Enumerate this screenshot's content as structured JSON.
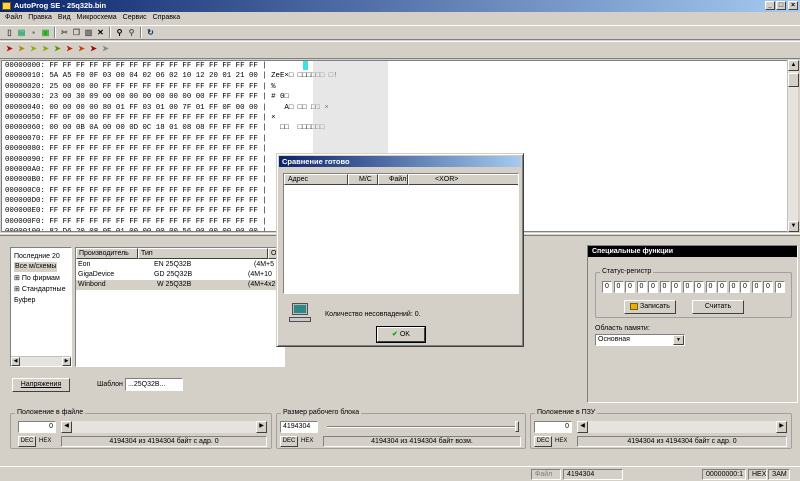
{
  "window": {
    "title": "AutoProg SE - 25q32b.bin",
    "min": "_",
    "max": "□",
    "close": "×"
  },
  "menu": [
    "Файл",
    "Правка",
    "Вид",
    "Микросхема",
    "Сервис",
    "Справка"
  ],
  "hex": {
    "rows": [
      [
        "00000000:",
        "FF FF FF FF FF FF FF FF FF FF FF FF FF FF FF FF |",
        ""
      ],
      [
        "00000010:",
        "5A A5 F0 0F 03 00 04 02 06 02 10 12 20 01 21 00 |",
        "ZeE×□ □□□□□□ □!"
      ],
      [
        "00000020:",
        "25 00 00 00 FF FF FF FF FF FF FF FF FF FF FF FF |",
        "%"
      ],
      [
        "00000030:",
        "23 00 30 09 00 00 00 00 00 00 00 00 FF FF FF FF |",
        "# 0□"
      ],
      [
        "00000040:",
        "00 00 00 00 80 01 FF 03 01 00 7F 01 FF 0F 00 00 |",
        "   A□ □□ □□ ×"
      ],
      [
        "00000050:",
        "FF 0F 00 00 FF FF FF FF FF FF FF FF FF FF FF FF |",
        "×"
      ],
      [
        "00000060:",
        "00 00 0B 0A 00 00 0D 0C 18 01 08 08 FF FF FF FF |",
        "  □□  □□□□□□"
      ],
      [
        "00000070:",
        "FF FF FF FF FF FF FF FF FF FF FF FF FF FF FF FF |",
        ""
      ],
      [
        "00000080:",
        "FF FF FF FF FF FF FF FF FF FF FF FF FF FF FF FF |",
        ""
      ],
      [
        "00000090:",
        "FF FF FF FF FF FF FF FF FF FF FF FF FF FF FF FF |",
        ""
      ],
      [
        "000000A0:",
        "FF FF FF FF FF FF FF FF FF FF FF FF FF FF FF FF |",
        ""
      ],
      [
        "000000B0:",
        "FF FF FF FF FF FF FF FF FF FF FF FF FF FF FF FF |",
        ""
      ],
      [
        "000000C0:",
        "FF FF FF FF FF FF FF FF FF FF FF FF FF FF FF FF |",
        ""
      ],
      [
        "000000D0:",
        "FF FF FF FF FF FF FF FF FF FF FF FF FF FF FF FF |",
        ""
      ],
      [
        "000000E0:",
        "FF FF FF FF FF FF FF FF FF FF FF FF FF FF FF FF |",
        ""
      ],
      [
        "000000F0:",
        "FF FF FF FF FF FF FF FF FF FF FF FF FF FF FF FF |",
        ""
      ],
      [
        "00000100:",
        "82 D6 20 08 0F 01 00 00 00 00 56 00 00 00 00 00 |",
        ""
      ]
    ]
  },
  "tree": [
    "Последние 20",
    "Все м/схемы",
    "По фирмам",
    "Стандартные",
    "Буфер"
  ],
  "chip_list": {
    "headers": [
      "Производитель",
      "Тип",
      "О"
    ],
    "rows": [
      [
        "Eon",
        "EN 25Q32B",
        "(4M+5"
      ],
      [
        "GigaDevice",
        "GD 25Q32B",
        "(4M+10"
      ],
      [
        "Winbond",
        "W 25Q32B",
        "(4M+4x2"
      ]
    ]
  },
  "voltage_button": "Напряжения",
  "template": {
    "label": "Шаблон",
    "value": "...25Q32B..."
  },
  "special": {
    "title": "Специальные функции",
    "status_group": "Статус-регистр",
    "bits": [
      "0",
      "0",
      "0",
      "0",
      "0",
      "0",
      "0",
      "0",
      "0",
      "0",
      "0",
      "0",
      "0",
      "0",
      "0",
      "0"
    ],
    "write": "Записать",
    "read": "Считать",
    "memory_label": "Область памяти:",
    "memory_value": "Основная"
  },
  "pos_file": {
    "title": "Положение в файле",
    "value": "0",
    "dec": "DEC",
    "hex": "HEX",
    "info": "4194304 из 4194304 байт с адр. 0"
  },
  "block": {
    "title": "Размер рабочего блока",
    "value": "4194304",
    "dec": "DEC",
    "hex": "HEX",
    "info": "4194304 из 4194304 байт возм."
  },
  "pos_rom": {
    "title": "Положение в ПЗУ",
    "value": "0",
    "dec": "DEC",
    "hex": "HEX",
    "info": "4194304 из 4194304 байт с адр. 0"
  },
  "dialog": {
    "title": "Сравнение готово",
    "headers": [
      "Адрес",
      "М/С",
      "Файл",
      "<XOR>"
    ],
    "message": "Количество несовпадений: 0.",
    "ok": "OK"
  },
  "status": {
    "file": "Файл",
    "size": "4194304",
    "addr": "00000000:1",
    "mode": "HEX",
    "ins": "ЗАМ"
  }
}
